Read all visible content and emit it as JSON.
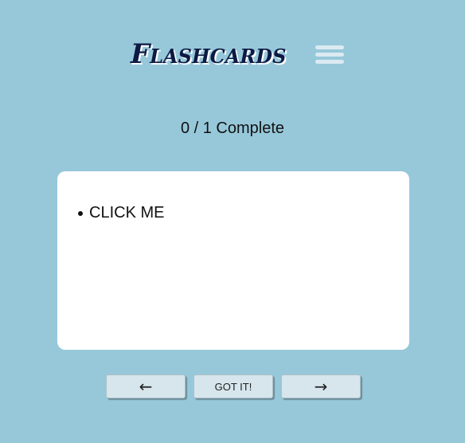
{
  "header": {
    "title": "Flashcards",
    "menu_icon": "hamburger-menu-icon"
  },
  "progress": {
    "text": "0 / 1 Complete",
    "completed": 0,
    "total": 1
  },
  "card": {
    "items": [
      "CLICK ME"
    ]
  },
  "controls": {
    "prev_icon": "←",
    "got_it_label": "GOT IT!",
    "next_icon": "→"
  },
  "colors": {
    "background": "#97c8da",
    "title": "#0d1a44",
    "card": "#ffffff",
    "button": "#d7e6ec"
  }
}
